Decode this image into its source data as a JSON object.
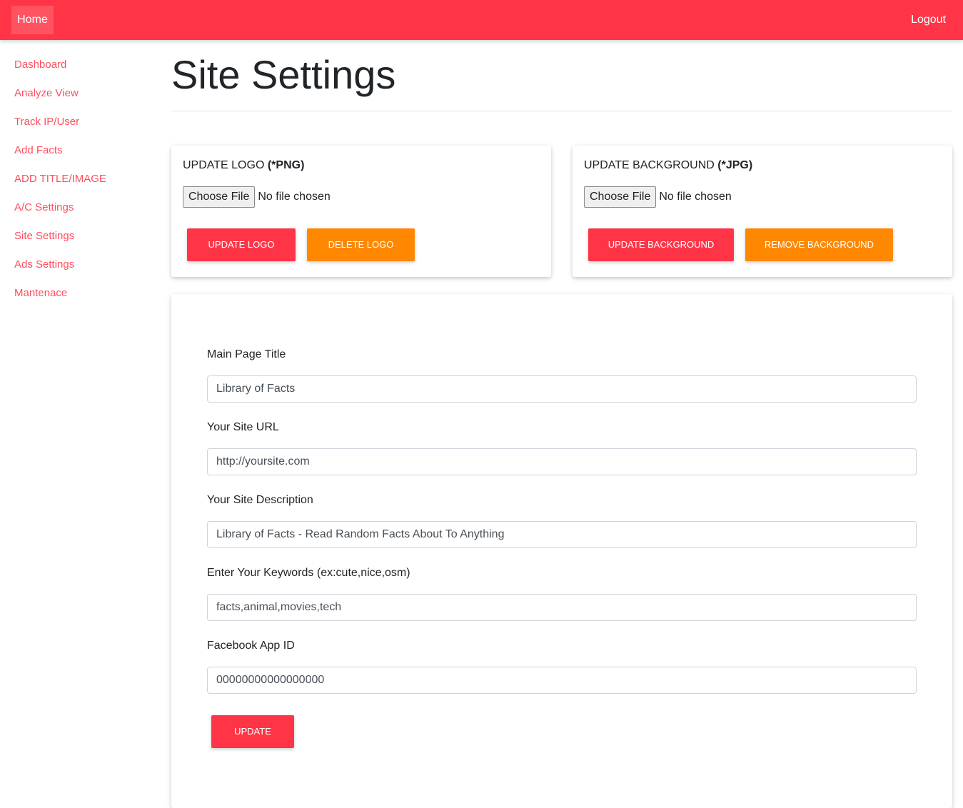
{
  "nav": {
    "home": "Home",
    "logout": "Logout"
  },
  "sidebar": {
    "items": [
      "Dashboard",
      "Analyze View",
      "Track IP/User",
      "Add Facts",
      "ADD TITLE/IMAGE",
      "A/C Settings",
      "Site Settings",
      "Ads Settings",
      "Mantenace"
    ]
  },
  "page_title": "Site Settings",
  "logo_card": {
    "title": "UPDATE LOGO ",
    "title_bold": "(*PNG)",
    "choose": "Choose File",
    "no_file": "No file chosen",
    "update": "UPDATE LOGO",
    "delete": "DELETE LOGO"
  },
  "bg_card": {
    "title": "UPDATE BACKGROUND ",
    "title_bold": "(*JPG)",
    "choose": "Choose File",
    "no_file": "No file chosen",
    "update": "UPDATE BACKGROUND",
    "remove": "REMOVE BACKGROUND"
  },
  "form": {
    "fields": [
      {
        "label": "Main Page Title",
        "value": "Library of Facts"
      },
      {
        "label": "Your Site URL",
        "value": "http://yoursite.com"
      },
      {
        "label": "Your Site Description",
        "value": "Library of Facts - Read Random Facts About To Anything"
      },
      {
        "label": "Enter Your Keywords (ex:cute,nice,osm)",
        "value": "facts,animal,movies,tech"
      },
      {
        "label": "Facebook App ID",
        "value": "00000000000000000"
      }
    ],
    "submit": "UPDATE"
  },
  "colors": {
    "primary": "#ff3547",
    "warning": "#ff8800"
  }
}
